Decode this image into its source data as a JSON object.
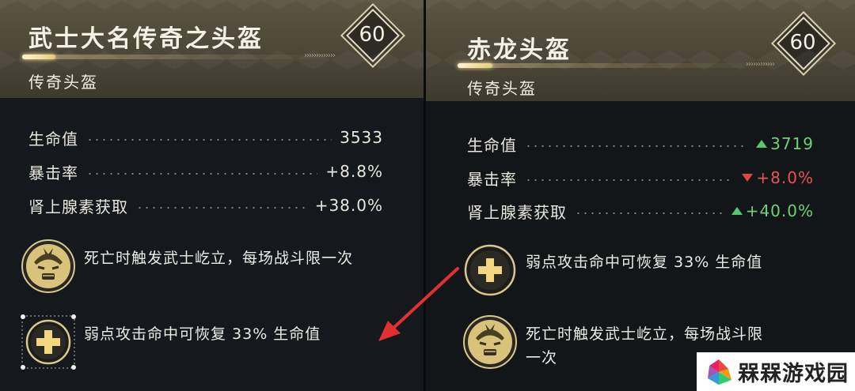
{
  "left": {
    "title": "武士大名传奇之头盔",
    "subtitle": "传奇头盔",
    "level": "60",
    "stats": [
      {
        "label": "生命值",
        "value": "3533"
      },
      {
        "label": "暴击率",
        "value": "+8.8%"
      },
      {
        "label": "肾上腺素获取",
        "value": "+38.0%"
      }
    ],
    "perks": [
      {
        "icon": "samurai-mask-icon",
        "text": "死亡时触发武士屹立，每场战斗限一次"
      },
      {
        "icon": "plus-heal-icon",
        "text": "弱点攻击命中可恢复 33% 生命值"
      }
    ]
  },
  "right": {
    "title": "赤龙头盔",
    "subtitle": "传奇头盔",
    "level": "60",
    "stats": [
      {
        "label": "生命值",
        "value": "3719",
        "trend": "up"
      },
      {
        "label": "暴击率",
        "value": "+8.0%",
        "trend": "down"
      },
      {
        "label": "肾上腺素获取",
        "value": "+40.0%",
        "trend": "up"
      }
    ],
    "perks": [
      {
        "icon": "plus-heal-icon",
        "text": "弱点攻击命中可恢复 33% 生命值"
      },
      {
        "icon": "samurai-mask-icon",
        "text": "死亡时触发武士屹立，每场战斗限一次"
      }
    ]
  },
  "watermark": {
    "text": "槑槑游戏园"
  },
  "colors": {
    "up": "#6fd07a",
    "down": "#e65454",
    "gold": "#d9cfae",
    "arrow": "#e03030"
  }
}
